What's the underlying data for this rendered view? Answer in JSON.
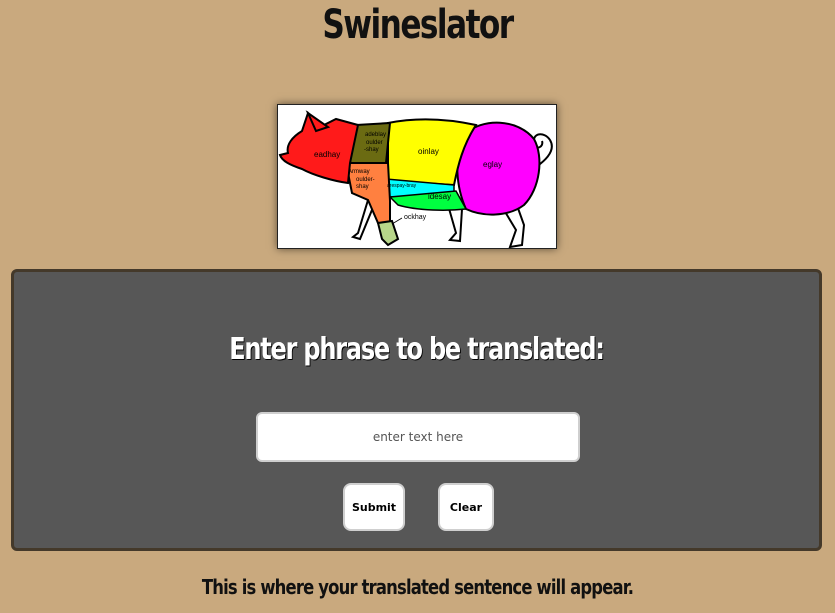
{
  "app": {
    "title": "Swineslator"
  },
  "pig_diagram": {
    "labels": {
      "head": "eadhay",
      "shoulder_blade_1": "adeblay",
      "shoulder_blade_2": "oulder",
      "shoulder_blade_3": "-shay",
      "loin": "oinlay",
      "leg": "eglay",
      "arm_1": "Armway",
      "arm_2": "oulder-",
      "arm_3": "shay",
      "spare_ribs": "arespay-bray",
      "side": "idesay",
      "hock": "ockhay"
    },
    "colors": {
      "head": "#ff1a1a",
      "shoulder_blade": "#6b6b12",
      "loin": "#ffff00",
      "leg": "#ff00ff",
      "arm": "#ff8040",
      "spare_ribs": "#00ffff",
      "side": "#00ff40",
      "hock": "#b8d68a"
    }
  },
  "translator": {
    "prompt": "Enter phrase to be translated:",
    "input_placeholder": "enter text here",
    "input_value": "",
    "submit_label": "Submit",
    "clear_label": "Clear"
  },
  "output": {
    "text": "This is where your translated sentence will appear."
  }
}
